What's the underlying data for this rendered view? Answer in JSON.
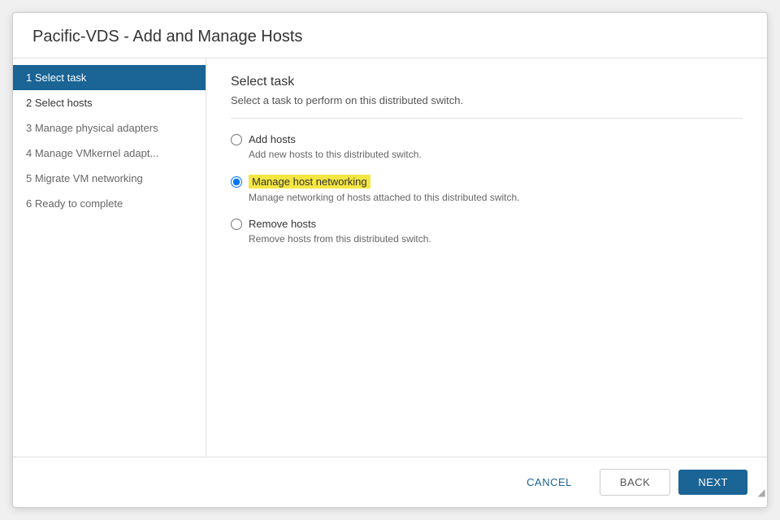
{
  "dialog": {
    "title": "Pacific-VDS - Add and Manage Hosts",
    "sidebar": {
      "items": [
        {
          "id": "step1",
          "label": "1 Select task",
          "state": "active"
        },
        {
          "id": "step2",
          "label": "2 Select hosts",
          "state": "enabled"
        },
        {
          "id": "step3",
          "label": "3 Manage physical adapters",
          "state": "disabled"
        },
        {
          "id": "step4",
          "label": "4 Manage VMkernel adapt...",
          "state": "disabled"
        },
        {
          "id": "step5",
          "label": "5 Migrate VM networking",
          "state": "disabled"
        },
        {
          "id": "step6",
          "label": "6 Ready to complete",
          "state": "disabled"
        }
      ]
    },
    "main": {
      "section_title": "Select task",
      "section_subtitle": "Select a task to perform on this distributed switch.",
      "options": [
        {
          "id": "add-hosts",
          "label": "Add hosts",
          "description": "Add new hosts to this distributed switch.",
          "selected": false,
          "highlighted": false
        },
        {
          "id": "manage-host-networking",
          "label": "Manage host networking",
          "description": "Manage networking of hosts attached to this distributed switch.",
          "selected": true,
          "highlighted": true
        },
        {
          "id": "remove-hosts",
          "label": "Remove hosts",
          "description": "Remove hosts from this distributed switch.",
          "selected": false,
          "highlighted": false
        }
      ]
    },
    "footer": {
      "cancel_label": "CANCEL",
      "back_label": "BACK",
      "next_label": "NEXT"
    }
  }
}
